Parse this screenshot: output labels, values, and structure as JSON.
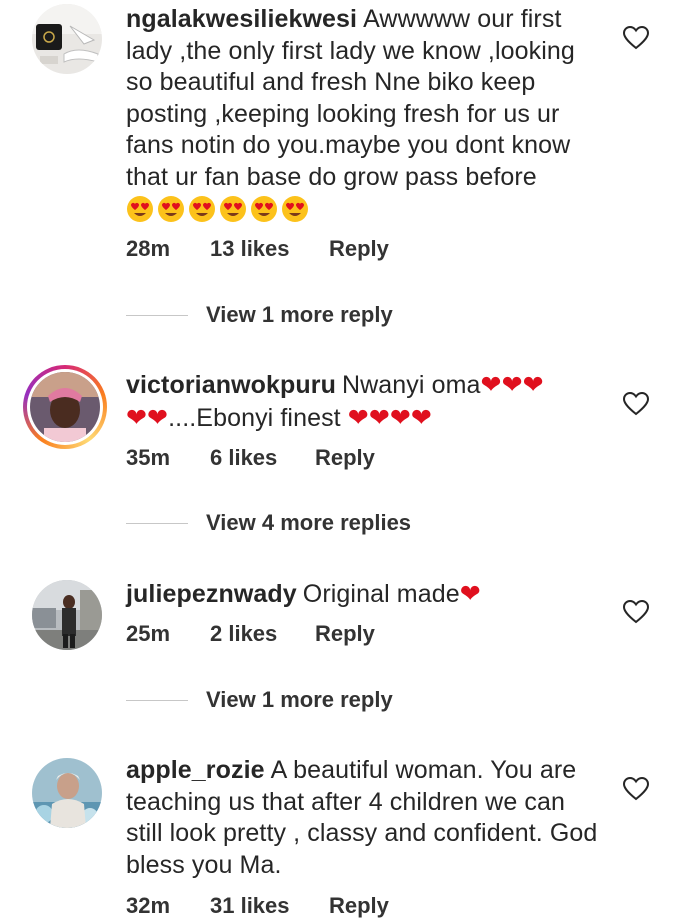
{
  "colors": {
    "text": "#262626",
    "meta": "#333333",
    "divider": "#c7c7c7",
    "heart": "#e0101e",
    "story_ring": [
      "#d62976",
      "#fa7e1e",
      "#feda75",
      "#962fbf"
    ]
  },
  "comments": [
    {
      "username": "ngalakwesiliekwesi",
      "text": "Awwwww our first lady ,the only first lady we know ,looking so beautiful and fresh Nne biko keep posting ,keeping looking fresh for us ur fans notin do you.maybe you dont know that ur fan base do grow pass before",
      "emojis": "😍😍😍😍😍😍",
      "time": "28m",
      "likes": "13 likes",
      "reply": "Reply",
      "view_replies": "View 1 more reply",
      "like_icon": "heart-outline-icon"
    },
    {
      "username": "victorianwokpuru",
      "text_before": "Nwanyi oma",
      "hearts_1": "❤❤❤",
      "hearts_2": "❤❤",
      "text_mid": "....Ebonyi finest ",
      "hearts_3": "❤❤❤❤",
      "time": "35m",
      "likes": "6 likes",
      "reply": "Reply",
      "view_replies": "View 4 more replies",
      "like_icon": "heart-outline-icon"
    },
    {
      "username": "juliepeznwady",
      "text": "Original made",
      "hearts": "❤",
      "time": "25m",
      "likes": "2 likes",
      "reply": "Reply",
      "view_replies": "View 1 more reply",
      "like_icon": "heart-outline-icon"
    },
    {
      "username": "apple_rozie",
      "text": "A beautiful woman. You are teaching us that  after 4 children we can still look pretty , classy and confident. God bless you Ma.",
      "time": "32m",
      "likes": "31 likes",
      "reply": "Reply",
      "like_icon": "heart-outline-icon"
    }
  ]
}
